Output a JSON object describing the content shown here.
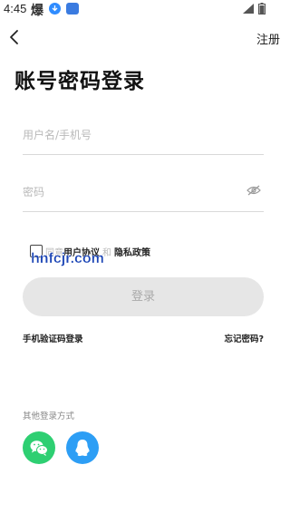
{
  "status_bar": {
    "time": "4:45",
    "app_glyph": "爆"
  },
  "header": {
    "register_label": "注册"
  },
  "page_title": "账号密码登录",
  "form": {
    "username_placeholder": "用户名/手机号",
    "password_placeholder": "密码"
  },
  "agreement": {
    "prefix": "同意",
    "user_agreement": "用户协议",
    "conjunction": "和",
    "privacy_policy": "隐私政策",
    "checked": false
  },
  "watermark": "hnfcjr.com",
  "login_button": "登录",
  "links": {
    "sms_login": "手机验证码登录",
    "forgot_password": "忘记密码?"
  },
  "other_login": {
    "label": "其他登录方式",
    "providers": [
      {
        "icon": "wechat-icon",
        "color": "#2ecf72"
      },
      {
        "icon": "qq-icon",
        "color": "#2d9ef5"
      }
    ]
  }
}
